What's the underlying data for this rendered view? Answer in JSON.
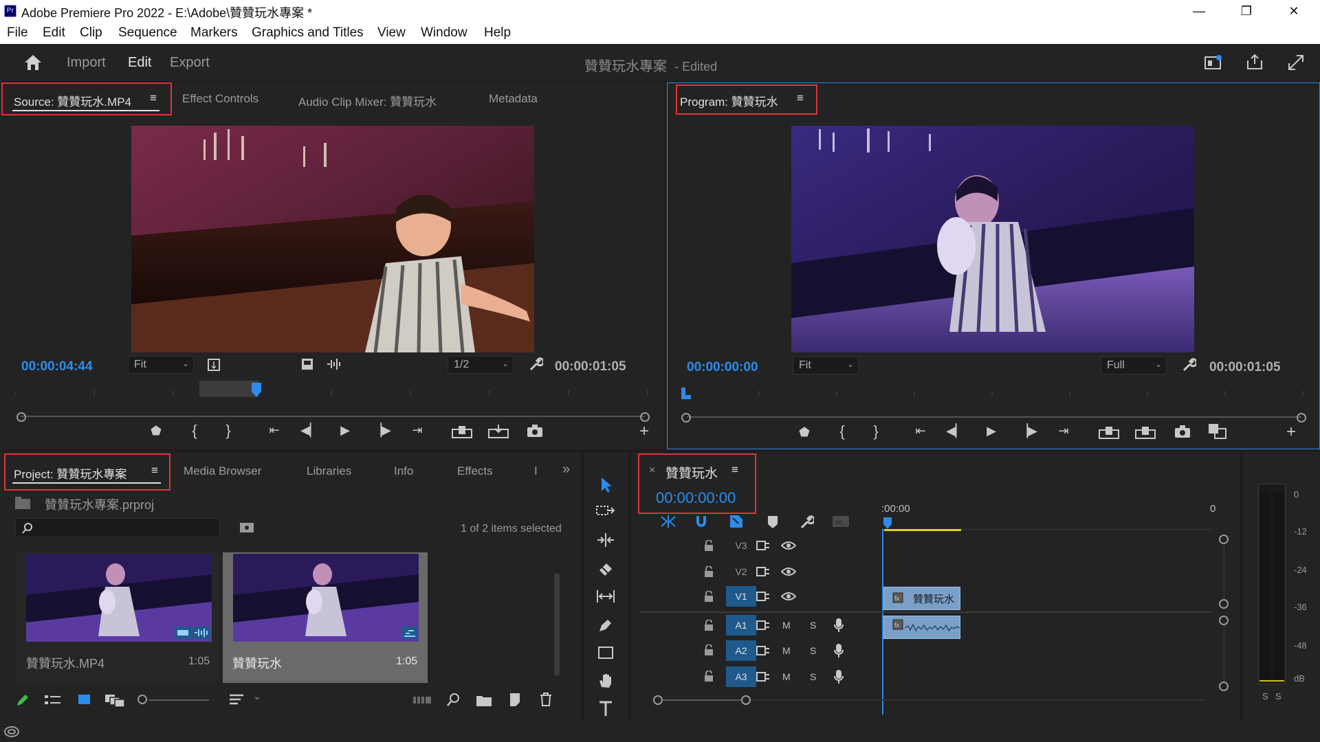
{
  "window": {
    "logo": "Pr",
    "title": "Adobe Premiere Pro 2022 - E:\\Adobe\\贊贊玩水專案 *",
    "controls": {
      "minimize": "—",
      "maximize": "❐",
      "close": "✕"
    }
  },
  "menu": [
    "File",
    "Edit",
    "Clip",
    "Sequence",
    "Markers",
    "Graphics and Titles",
    "View",
    "Window",
    "Help"
  ],
  "header": {
    "workspaces": [
      "Import",
      "Edit",
      "Export"
    ],
    "active_workspace": "Edit",
    "project_title": "贊贊玩水專案",
    "project_status": "- Edited"
  },
  "source_panel": {
    "tabs": [
      "Source: 贊贊玩水.MP4",
      "Effect Controls",
      "Audio Clip Mixer: 贊贊玩水",
      "Metadata"
    ],
    "menu_icon": "≡",
    "timecode_current": "00:00:04:44",
    "timecode_duration": "00:00:01:05",
    "zoom": "Fit",
    "resolution": "1/2",
    "playhead_fraction": 0.38
  },
  "program_panel": {
    "tab": "Program: 贊贊玩水",
    "menu_icon": "≡",
    "timecode_current": "00:00:00:00",
    "timecode_duration": "00:00:01:05",
    "zoom": "Fit",
    "resolution": "Full"
  },
  "project_panel": {
    "tabs": [
      "Project: 贊贊玩水專案",
      "Media Browser",
      "Libraries",
      "Info",
      "Effects",
      "I"
    ],
    "menu_icon": "≡",
    "overflow": "»",
    "file": "贊贊玩水專案.prproj",
    "search_placeholder": "",
    "selection_info": "1 of 2 items selected",
    "items": [
      {
        "name": "贊贊玩水.MP4",
        "duration": "1:05",
        "selected": false
      },
      {
        "name": "贊贊玩水",
        "duration": "1:05",
        "selected": true
      }
    ]
  },
  "timeline": {
    "close_icon": "×",
    "sequence_name": "贊贊玩水",
    "menu_icon": "≡",
    "timecode": "00:00:00:00",
    "ruler_start": ":00:00",
    "ruler_end": "0",
    "video_tracks": [
      "V3",
      "V2",
      "V1"
    ],
    "audio_tracks": [
      "A1",
      "A2",
      "A3"
    ],
    "clip_video_label": "贊贊玩水",
    "m_label": "M",
    "s_label": "S"
  },
  "meter": {
    "labels": [
      "0",
      "-12",
      "-24",
      "-36",
      "-48",
      "dB"
    ],
    "solo": [
      "S",
      "S"
    ]
  },
  "colors": {
    "accent_blue": "#2d8ceb",
    "highlight_red": "#e2313b",
    "panel_bg": "#232323"
  }
}
